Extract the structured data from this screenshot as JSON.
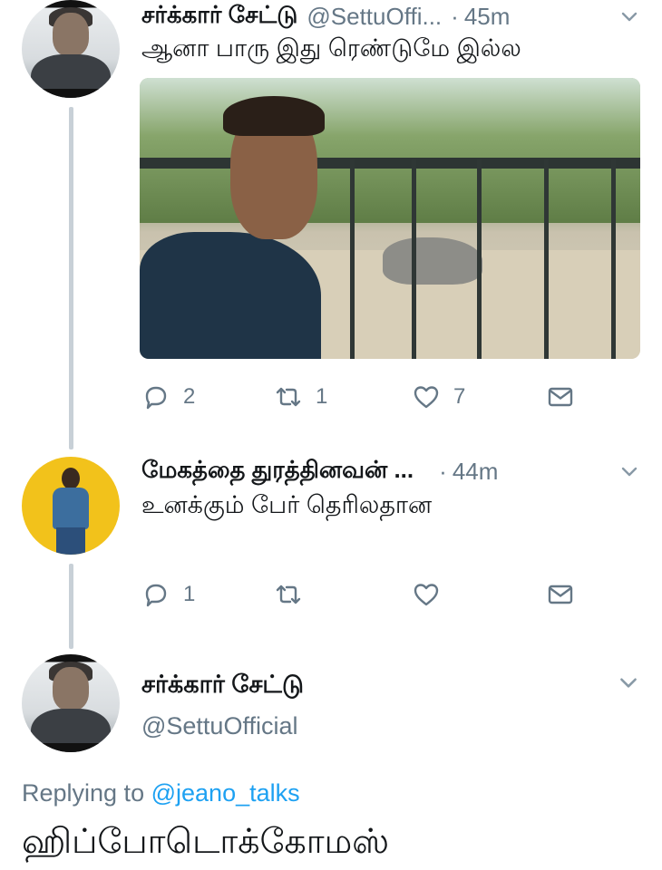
{
  "tweet1": {
    "name": "சர்க்கார் சேட்டு",
    "handle": "@SettuOffi...",
    "dot": "·",
    "time": "45m",
    "text": "ஆனா பாரு இது ரெண்டுமே இல்ல",
    "actions": {
      "reply_count": "2",
      "retweet_count": "1",
      "like_count": "7"
    }
  },
  "tweet2": {
    "name": "மேகத்தை துரத்தினவன் ...",
    "dot": "·",
    "time": "44m",
    "text": "உனக்கும் பேர் தெரிலதான",
    "actions": {
      "reply_count": "1"
    }
  },
  "main_tweet": {
    "name": "சர்க்கார் சேட்டு",
    "handle": "@SettuOfficial",
    "replying_prefix": "Replying to",
    "replying_mention": "@jeano_talks",
    "text": "ஹிப்போடொக்கோமஸ்"
  },
  "colors": {
    "secondary_text": "#657786",
    "link": "#1da1f2",
    "thread_line": "#c8d0d7"
  },
  "icons": [
    "reply-icon",
    "retweet-icon",
    "like-icon",
    "dm-icon",
    "chevron-down-icon"
  ]
}
